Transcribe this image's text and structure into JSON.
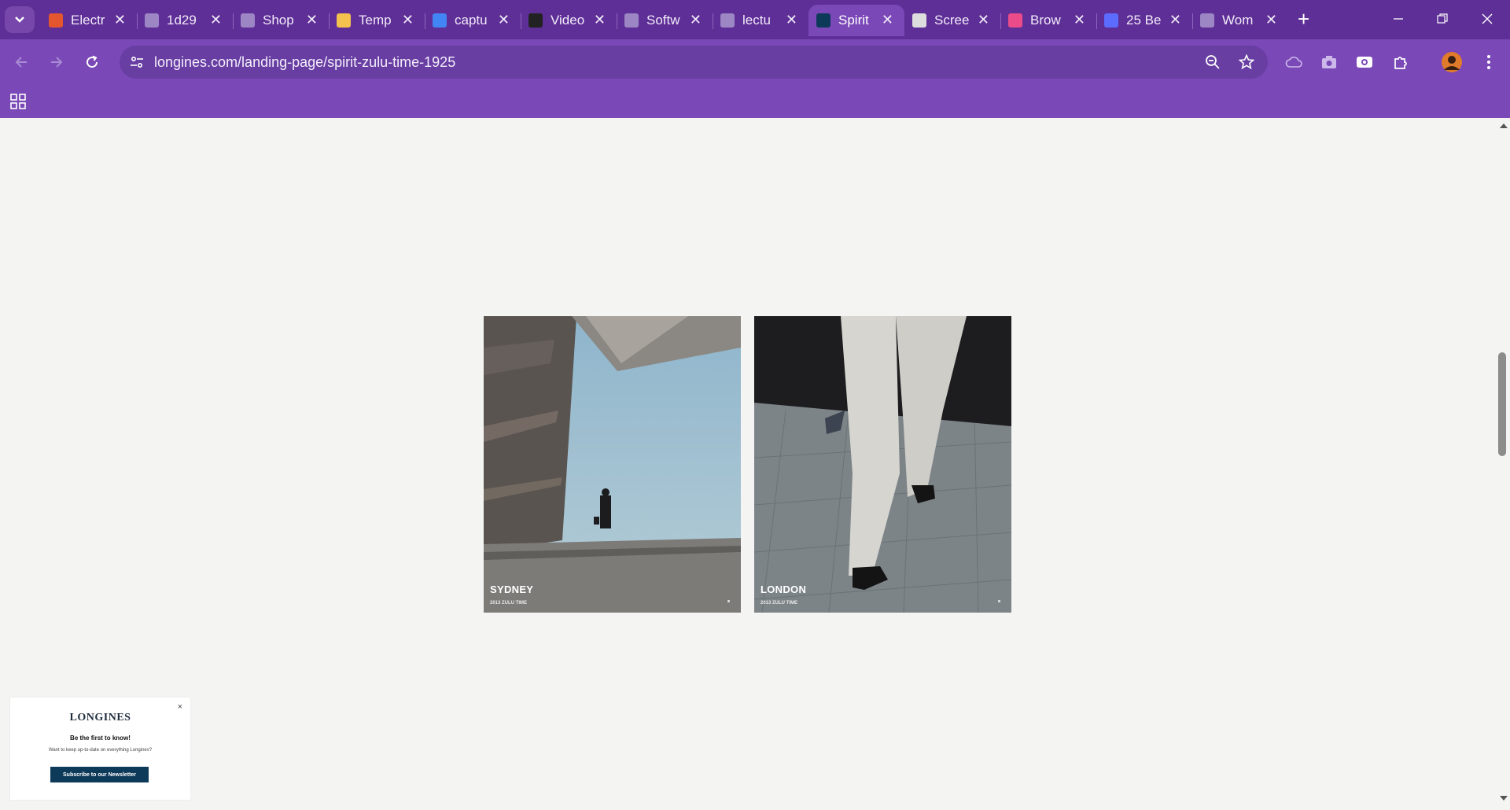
{
  "browser": {
    "tabs": [
      {
        "title": "Electr",
        "favicon": "orange-logo-icon",
        "color": "#e4572e"
      },
      {
        "title": "1d29",
        "favicon": "globe-icon",
        "color": "#9c86c4"
      },
      {
        "title": "Shop",
        "favicon": "dash-icon",
        "color": "#9c86c4"
      },
      {
        "title": "Temp",
        "favicon": "envelope-icon",
        "color": "#f2c14e"
      },
      {
        "title": "captu",
        "favicon": "google-icon",
        "color": "#4285f4"
      },
      {
        "title": "Video",
        "favicon": "film-icon",
        "color": "#222222"
      },
      {
        "title": "Softw",
        "favicon": "globe-icon",
        "color": "#9c86c4"
      },
      {
        "title": "lectu",
        "favicon": "globe-icon",
        "color": "#9c86c4"
      },
      {
        "title": "Spirit",
        "favicon": "longines-icon",
        "color": "#0e3a5a",
        "active": true
      },
      {
        "title": "Scree",
        "favicon": "camera-icon",
        "color": "#dddddd"
      },
      {
        "title": "Brow",
        "favicon": "dribbble-icon",
        "color": "#ea4c89"
      },
      {
        "title": "25 Be",
        "favicon": "h-logo-icon",
        "color": "#5b6cff"
      },
      {
        "title": "Wom",
        "favicon": "dash-icon",
        "color": "#9c86c4"
      }
    ],
    "url": "longines.com/landing-page/spirit-zulu-time-1925"
  },
  "page": {
    "cards": [
      {
        "city": "SYDNEY",
        "subtitle": "2013 ZULU TIME"
      },
      {
        "city": "LONDON",
        "subtitle": "2013 ZULU TIME"
      }
    ],
    "newsletter": {
      "logo": "LONGINES",
      "close": "×",
      "title": "Be the first to know!",
      "text": "Want to keep up-to-date on everything Longines?",
      "button": "Subscribe to our Newsletter"
    }
  },
  "colors": {
    "tabbar": "#5e2f96",
    "toolbar": "#7a48b7",
    "page_bg": "#f4f4f2",
    "newsletter_button": "#0e3a5a"
  }
}
